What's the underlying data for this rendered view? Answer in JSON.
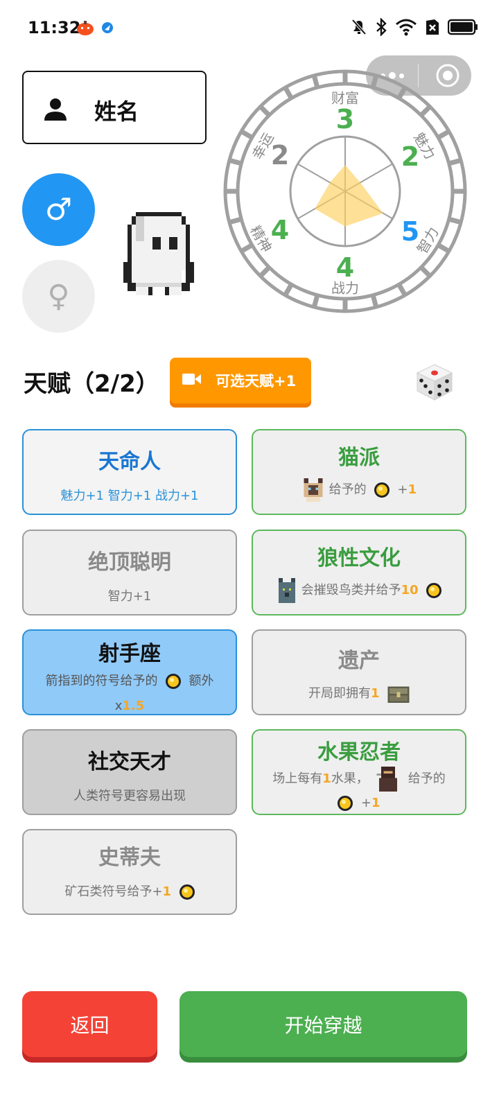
{
  "status_bar": {
    "time": "11:32",
    "icons": [
      "pumpkin-app-icon",
      "app-icon",
      "mute-icon",
      "bluetooth-icon",
      "wifi-icon",
      "sim-icon",
      "battery-icon"
    ]
  },
  "capsule": {
    "icons": [
      "more-icon",
      "close-target-icon"
    ]
  },
  "profile": {
    "name_placeholder": "姓名",
    "gender_male": "♂",
    "gender_female": "♀",
    "selected_gender": "male"
  },
  "stats": {
    "wealth": {
      "label": "财富",
      "value": "3"
    },
    "charm": {
      "label": "魅力",
      "value": "2"
    },
    "intelligence": {
      "label": "智力",
      "value": "5"
    },
    "combat": {
      "label": "战力",
      "value": "4"
    },
    "spirit": {
      "label": "精神",
      "value": "4"
    },
    "luck": {
      "label": "幸运",
      "value": "2"
    }
  },
  "talents": {
    "title": "天赋（2/2）",
    "add_button": "可选天赋+1",
    "cards": [
      {
        "title": "天命人",
        "desc": "魅力+1 智力+1 战力+1"
      },
      {
        "title": "猫派",
        "desc_a": "给予的",
        "desc_b": "+",
        "num": "1"
      },
      {
        "title": "绝顶聪明",
        "desc": "智力+1"
      },
      {
        "title": "狼性文化",
        "desc_a": "会摧毁鸟类并给予",
        "num": "10"
      },
      {
        "title": "射手座",
        "desc_a": "箭指到的符号给予的",
        "desc_b": "额外",
        "desc_c": "x",
        "num": "1.5"
      },
      {
        "title": "遗产",
        "desc_a": "开局即拥有",
        "num": "1"
      },
      {
        "title": "社交天才",
        "desc": "人类符号更容易出现"
      },
      {
        "title": "水果忍者",
        "desc_a": "场上每有",
        "num": "1",
        "desc_b": "水果，",
        "desc_c": "给予的",
        "desc_d": "+",
        "num2": "1"
      },
      {
        "title": "史蒂夫",
        "desc_a": "矿石类符号给予+",
        "num": "1"
      }
    ]
  },
  "buttons": {
    "back": "返回",
    "start": "开始穿越"
  },
  "colors": {
    "blue": "#2196f3",
    "green": "#4caf50",
    "orange": "#ff9800",
    "red": "#f44336",
    "highlight_number": "#f5a623"
  }
}
